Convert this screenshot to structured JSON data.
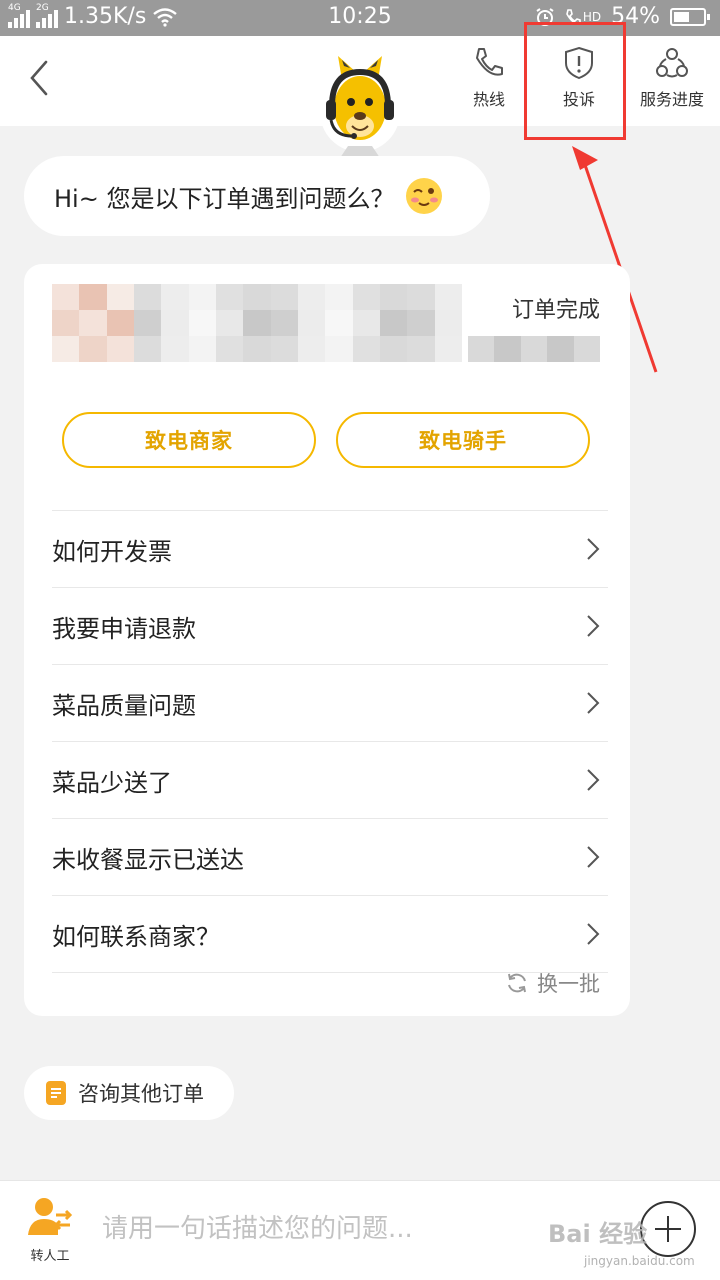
{
  "status_bar": {
    "sim1": "4G",
    "sim2": "2G",
    "speed": "1.35K/s",
    "time": "10:25",
    "hd": "HD",
    "battery": "54%",
    "battery_level": 0.54
  },
  "header": {
    "hotline_label": "热线",
    "complain_label": "投诉",
    "progress_label": "服务进度"
  },
  "greeting": "Hi~ 您是以下订单遇到问题么？",
  "order": {
    "status": "订单完成",
    "call_merchant": "致电商家",
    "call_rider": "致电骑手"
  },
  "questions": [
    "如何开发票",
    "我要申请退款",
    "菜品质量问题",
    "菜品少送了",
    "未收餐显示已送达",
    "如何联系商家？"
  ],
  "refresh_label": "换一批",
  "other_orders_label": "咨询其他订单",
  "bottom": {
    "agent_label": "转人工",
    "input_placeholder": "请用一句话描述您的问题..."
  },
  "watermark": {
    "brand": "Bai 经验",
    "url": "jingyan.baidu.com"
  },
  "colors": {
    "accent": "#f5b800",
    "annotation": "#f03a32"
  }
}
